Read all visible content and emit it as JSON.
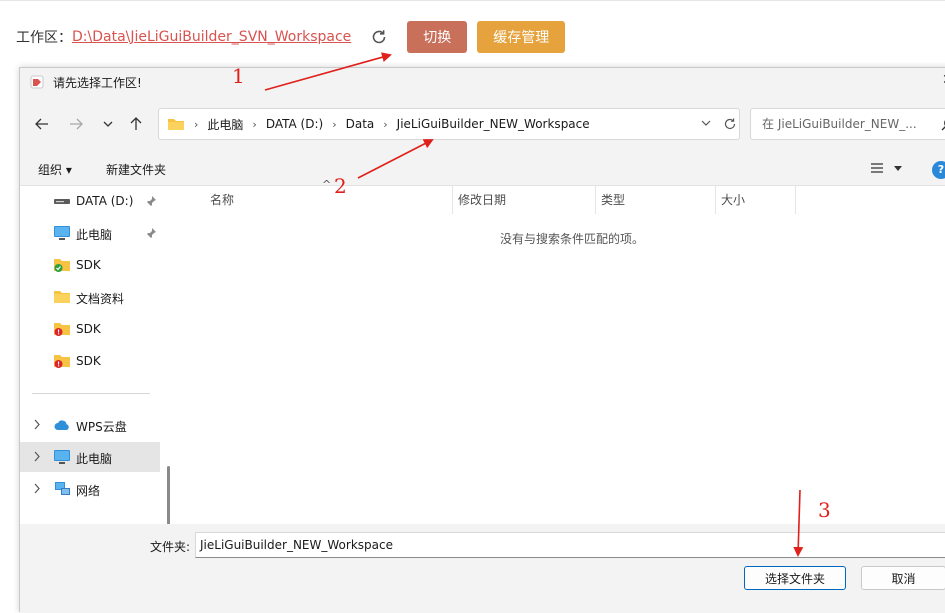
{
  "workspace": {
    "label": "工作区：",
    "path": "D:\\Data\\JieLiGuiBuilder_SVN_Workspace",
    "switch_label": "切换",
    "cache_label": "缓存管理"
  },
  "dialog": {
    "title": "请先选择工作区!",
    "breadcrumbs": [
      "此电脑",
      "DATA (D:)",
      "Data",
      "JieLiGuiBuilder_NEW_Workspace"
    ],
    "search_placeholder": "在 JieLiGuiBuilder_NEW_...",
    "organize_label": "组织 ▾",
    "new_folder_label": "新建文件夹",
    "sidebar": [
      {
        "label": "DATA (D:)",
        "icon": "drive-icon",
        "pinned": true
      },
      {
        "label": "此电脑",
        "icon": "computer-icon",
        "pinned": true
      },
      {
        "label": "SDK",
        "icon": "folder-sync-ok-icon"
      },
      {
        "label": "文档资料",
        "icon": "folder-icon"
      },
      {
        "label": "SDK",
        "icon": "folder-sync-error-icon"
      },
      {
        "label": "SDK",
        "icon": "folder-sync-error-icon"
      }
    ],
    "sidebar_tree": [
      {
        "label": "WPS云盘",
        "icon": "cloud-icon"
      },
      {
        "label": "此电脑",
        "icon": "computer-icon",
        "selected": true
      },
      {
        "label": "网络",
        "icon": "network-icon"
      }
    ],
    "columns": [
      "名称",
      "修改日期",
      "类型",
      "大小"
    ],
    "empty_message": "没有与搜索条件匹配的项。",
    "folder_label": "文件夹:",
    "folder_value": "JieLiGuiBuilder_NEW_Workspace",
    "select_button": "选择文件夹",
    "cancel_button": "取消"
  },
  "annotations": [
    "1",
    "2",
    "3"
  ],
  "colors": {
    "switch_bg": "#c8705a",
    "cache_bg": "#e6a23c",
    "path_link": "#d9534f",
    "annotation_red": "#e0201b"
  }
}
